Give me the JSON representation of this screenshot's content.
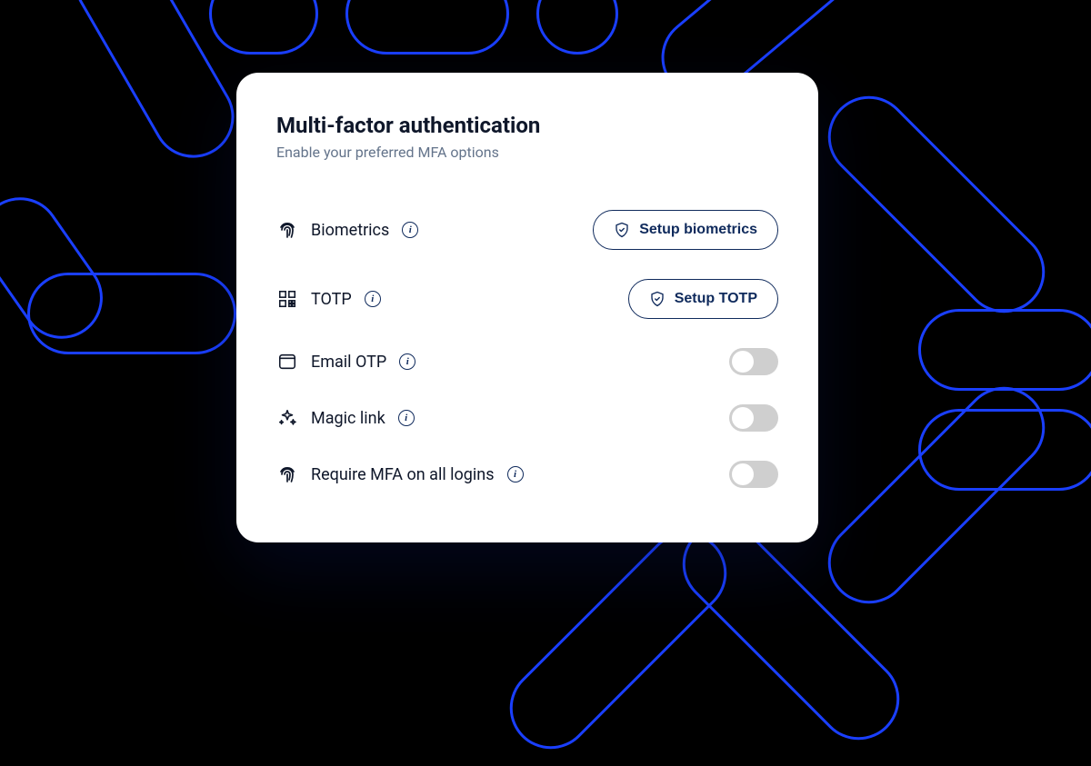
{
  "card": {
    "title": "Multi-factor authentication",
    "subtitle": "Enable your preferred MFA options"
  },
  "rows": {
    "biometrics": {
      "label": "Biometrics",
      "button": "Setup biometrics"
    },
    "totp": {
      "label": "TOTP",
      "button": "Setup TOTP"
    },
    "email_otp": {
      "label": "Email OTP"
    },
    "magic_link": {
      "label": "Magic link"
    },
    "require_mfa": {
      "label": "Require MFA on all logins"
    }
  },
  "colors": {
    "accent": "#1a3fff",
    "navy": "#0f2a5c"
  }
}
